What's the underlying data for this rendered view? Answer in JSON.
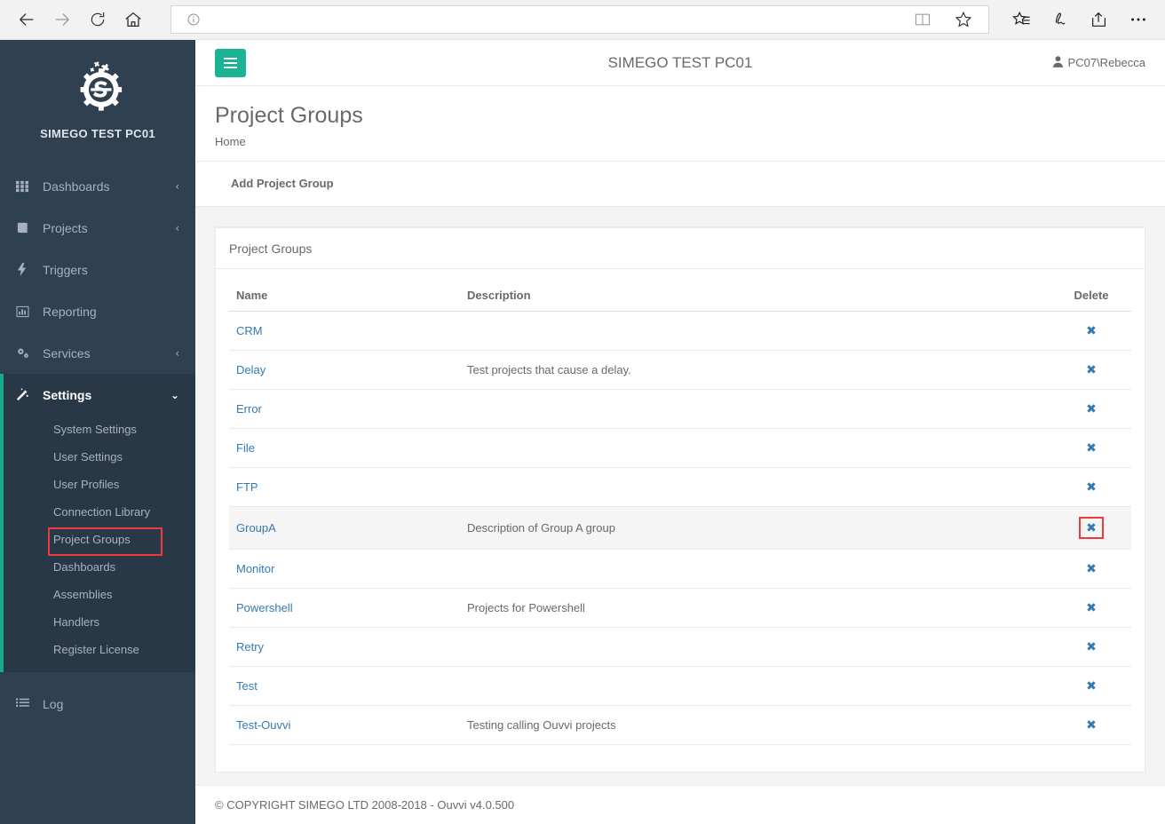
{
  "browser": {
    "back_icon": "arrow-left-icon",
    "forward_icon": "arrow-right-icon",
    "refresh_icon": "refresh-icon",
    "home_icon": "home-icon",
    "address_value": "",
    "address_placeholder": "",
    "info_icon": "info-icon",
    "reading_view_icon": "reading-view-icon",
    "favorite_icon": "star-icon",
    "hub_icon": "favorites-hub-icon",
    "web_note_icon": "web-note-icon",
    "share_icon": "share-icon",
    "more_icon": "more-options-icon"
  },
  "sidebar": {
    "brand_name": "SIMEGO TEST PC01",
    "logo_icon": "simego-gear-logo",
    "items": [
      {
        "label": "Dashboards",
        "icon": "grid-icon",
        "caret": "‹",
        "active": false
      },
      {
        "label": "Projects",
        "icon": "book-icon",
        "caret": "‹",
        "active": false
      },
      {
        "label": "Triggers",
        "icon": "bolt-icon",
        "caret": "",
        "active": false
      },
      {
        "label": "Reporting",
        "icon": "bar-chart-icon",
        "caret": "",
        "active": false
      },
      {
        "label": "Services",
        "icon": "cogs-icon",
        "caret": "‹",
        "active": false
      }
    ],
    "settings": {
      "label": "Settings",
      "icon": "magic-wand-icon",
      "caret": "⌄",
      "active": true,
      "subitems": [
        {
          "label": "System Settings",
          "highlight": false
        },
        {
          "label": "User Settings",
          "highlight": false
        },
        {
          "label": "User Profiles",
          "highlight": false
        },
        {
          "label": "Connection Library",
          "highlight": false
        },
        {
          "label": "Project Groups",
          "highlight": true
        },
        {
          "label": "Dashboards",
          "highlight": false
        },
        {
          "label": "Assemblies",
          "highlight": false
        },
        {
          "label": "Handlers",
          "highlight": false
        },
        {
          "label": "Register License",
          "highlight": false
        }
      ]
    },
    "bottom": {
      "label": "Log",
      "icon": "list-icon"
    }
  },
  "topbar": {
    "menu_toggle_icon": "hamburger-icon",
    "title": "SIMEGO TEST PC01",
    "user_icon": "user-icon",
    "user_name": "PC07\\Rebecca"
  },
  "page": {
    "title": "Project Groups",
    "breadcrumb": "Home"
  },
  "toolbar": {
    "add_label": "Add Project Group"
  },
  "card": {
    "title": "Project Groups",
    "columns": {
      "name": "Name",
      "description": "Description",
      "delete": "Delete"
    },
    "delete_icon": "✖",
    "rows": [
      {
        "name": "CRM",
        "description": "",
        "hovered": false,
        "delete_highlight": false
      },
      {
        "name": "Delay",
        "description": "Test projects that cause a delay.",
        "hovered": false,
        "delete_highlight": false
      },
      {
        "name": "Error",
        "description": "",
        "hovered": false,
        "delete_highlight": false
      },
      {
        "name": "File",
        "description": "",
        "hovered": false,
        "delete_highlight": false
      },
      {
        "name": "FTP",
        "description": "",
        "hovered": false,
        "delete_highlight": false
      },
      {
        "name": "GroupA",
        "description": "Description of Group A group",
        "hovered": true,
        "delete_highlight": true
      },
      {
        "name": "Monitor",
        "description": "",
        "hovered": false,
        "delete_highlight": false
      },
      {
        "name": "Powershell",
        "description": "Projects for Powershell",
        "hovered": false,
        "delete_highlight": false
      },
      {
        "name": "Retry",
        "description": "",
        "hovered": false,
        "delete_highlight": false
      },
      {
        "name": "Test",
        "description": "",
        "hovered": false,
        "delete_highlight": false
      },
      {
        "name": "Test-Ouvvi",
        "description": "Testing calling Ouvvi projects",
        "hovered": false,
        "delete_highlight": false
      }
    ]
  },
  "footer": {
    "copyright": "© COPYRIGHT SIMEGO LTD 2008-2018 - Ouvvi v4.0.500"
  },
  "colors": {
    "sidebar_bg": "#2f4050",
    "sidebar_active_bg": "#293846",
    "accent_teal": "#1ab394",
    "link_blue": "#337ab7",
    "annotation_red": "#f03a3a",
    "text_grey": "#676a6c"
  }
}
